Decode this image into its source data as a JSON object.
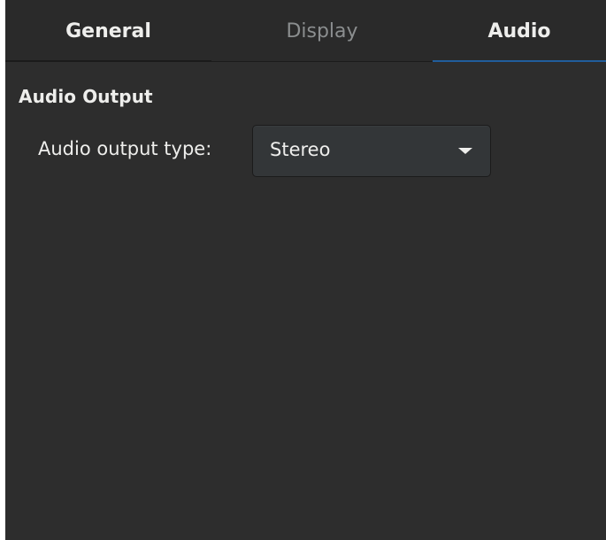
{
  "tabs": [
    {
      "label": "General",
      "state": "normal"
    },
    {
      "label": "Display",
      "state": "inactive"
    },
    {
      "label": "Audio",
      "state": "selected"
    }
  ],
  "audio": {
    "section_title": "Audio Output",
    "output_type_label": "Audio output type:",
    "output_type_value": "Stereo",
    "dropdown_icon": "pan-down-icon"
  },
  "colors": {
    "background": "#2d2d2d",
    "tabbar": "#2a2a2a",
    "accent": "#215d9c",
    "text": "#eeeeec",
    "text_inactive": "#8b8e8f"
  }
}
